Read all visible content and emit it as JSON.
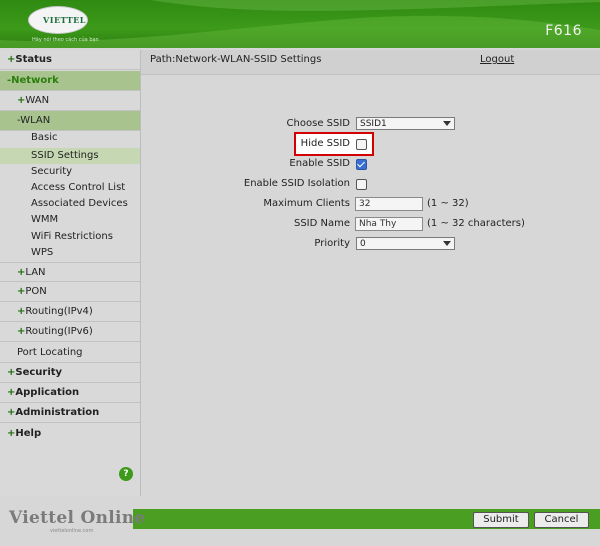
{
  "header": {
    "logo_text": "VIETTEL",
    "slogan": "Hãy nói theo cách của bạn",
    "model": "F616"
  },
  "sidebar": {
    "status": "Status",
    "network": "Network",
    "wan": "WAN",
    "wlan": "WLAN",
    "wlan_items": [
      "Basic",
      "SSID Settings",
      "Security",
      "Access Control List",
      "Associated Devices",
      "WMM",
      "WiFi Restrictions",
      "WPS"
    ],
    "lan": "LAN",
    "pon": "PON",
    "routing_v4": "Routing(IPv4)",
    "routing_v6": "Routing(IPv6)",
    "port_locating": "Port Locating",
    "security": "Security",
    "application": "Application",
    "administration": "Administration",
    "help": "Help",
    "help_icon": "?",
    "plus": "+",
    "minus": "-"
  },
  "main": {
    "path": "Path:Network-WLAN-SSID Settings",
    "logout": "Logout",
    "form": {
      "choose_ssid_label": "Choose SSID",
      "choose_ssid_value": "SSID1",
      "hide_ssid_label": "Hide SSID",
      "hide_ssid_checked": false,
      "enable_ssid_label": "Enable SSID",
      "enable_ssid_checked": true,
      "isolation_label": "Enable SSID Isolation",
      "isolation_checked": false,
      "max_clients_label": "Maximum Clients",
      "max_clients_value": "32",
      "max_clients_hint": "(1 ~ 32)",
      "ssid_name_label": "SSID Name",
      "ssid_name_value": "Nha Thy",
      "ssid_name_hint": "(1 ~ 32 characters)",
      "priority_label": "Priority",
      "priority_value": "0"
    }
  },
  "footer": {
    "brand": "Viettel Online",
    "brand_url": "viettelonline.com",
    "submit": "Submit",
    "cancel": "Cancel"
  },
  "colors": {
    "brand_green": "#3d9a1a",
    "highlight_red": "#d20000",
    "checkbox_blue": "#3b6fd1"
  }
}
